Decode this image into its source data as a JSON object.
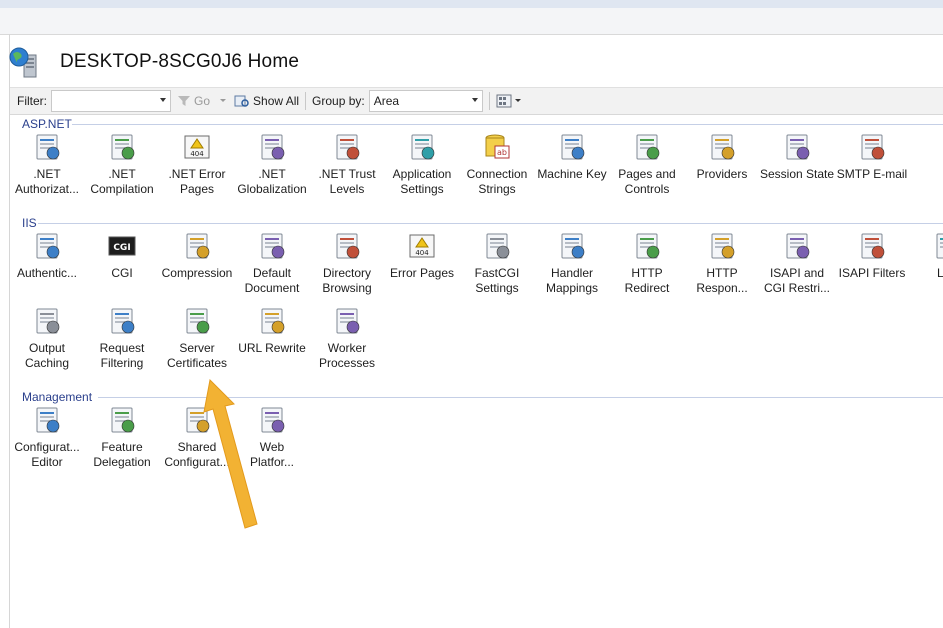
{
  "header": {
    "title": "DESKTOP-8SCG0J6 Home",
    "icon": "server-globe-icon"
  },
  "toolbar": {
    "filter_label": "Filter:",
    "filter_value": "",
    "go_label": "Go",
    "show_all_label": "Show All",
    "group_by_label": "Group by:",
    "group_by_value": "Area"
  },
  "groups": [
    {
      "name": "ASP.NET",
      "features": [
        {
          "label": ".NET\nAuthorizat..."
        },
        {
          "label": ".NET\nCompilation"
        },
        {
          "label": ".NET Error\nPages",
          "badge": "404"
        },
        {
          "label": ".NET\nGlobalization"
        },
        {
          "label": ".NET Trust\nLevels"
        },
        {
          "label": "Application\nSettings"
        },
        {
          "label": "Connection\nStrings",
          "badge": "ab"
        },
        {
          "label": "Machine Key"
        },
        {
          "label": "Pages and\nControls"
        },
        {
          "label": "Providers"
        },
        {
          "label": "Session State"
        },
        {
          "label": "SMTP E-mail"
        }
      ]
    },
    {
      "name": "IIS",
      "features": [
        {
          "label": "Authentic..."
        },
        {
          "label": "CGI",
          "badge": "CGI"
        },
        {
          "label": "Compression"
        },
        {
          "label": "Default\nDocument"
        },
        {
          "label": "Directory\nBrowsing"
        },
        {
          "label": "Error Pages",
          "badge": "404"
        },
        {
          "label": "FastCGI\nSettings"
        },
        {
          "label": "Handler\nMappings"
        },
        {
          "label": "HTTP\nRedirect"
        },
        {
          "label": "HTTP\nRespon..."
        },
        {
          "label": "ISAPI and\nCGI Restri..."
        },
        {
          "label": "ISAPI Filters"
        },
        {
          "label": "Log"
        },
        {
          "label": "Output\nCaching"
        },
        {
          "label": "Request\nFiltering"
        },
        {
          "label": "Server\nCertificates"
        },
        {
          "label": "URL Rewrite"
        },
        {
          "label": "Worker\nProcesses"
        }
      ]
    },
    {
      "name": "Management",
      "features": [
        {
          "label": "Configurat...\nEditor"
        },
        {
          "label": "Feature\nDelegation"
        },
        {
          "label": "Shared\nConfigurat..."
        },
        {
          "label": "Web\nPlatfor..."
        }
      ]
    }
  ],
  "annotation": {
    "color": "#f2b233",
    "target": "Server Certificates"
  }
}
